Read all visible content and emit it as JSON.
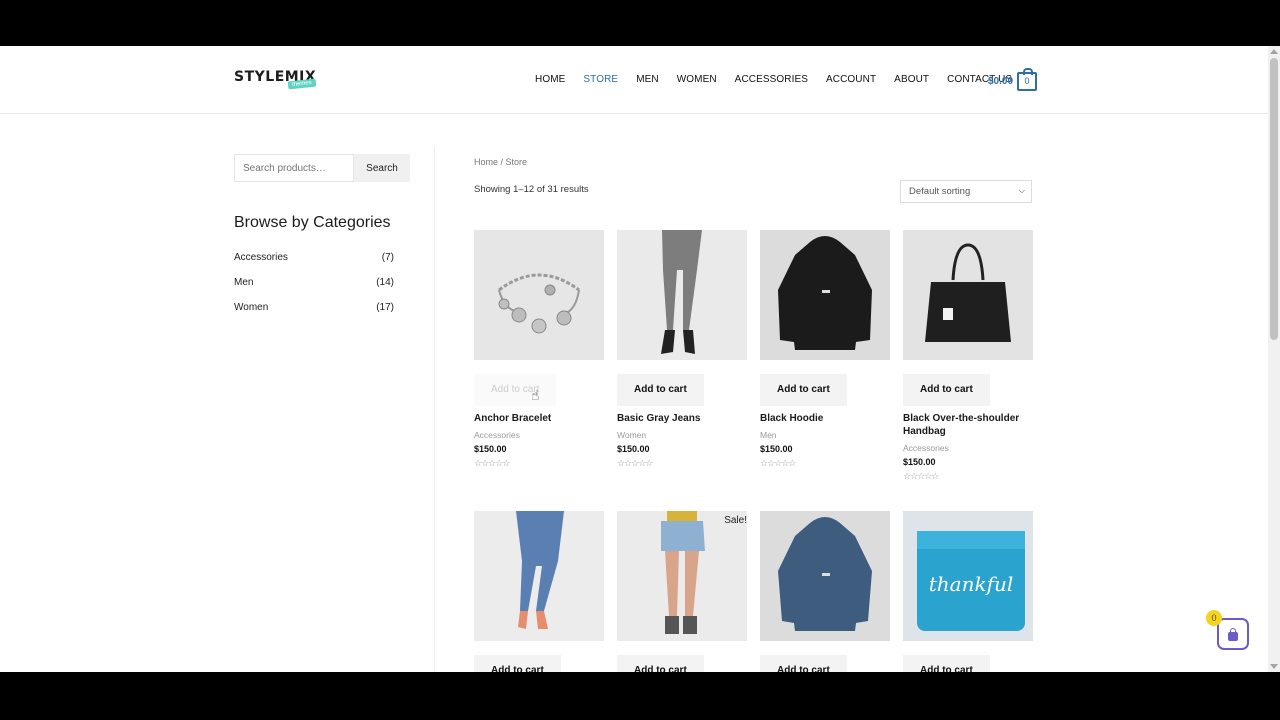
{
  "header": {
    "logo_text": "STYLEMIX",
    "logo_tag": "themes",
    "nav": [
      {
        "label": "HOME",
        "active": false
      },
      {
        "label": "STORE",
        "active": true
      },
      {
        "label": "MEN",
        "active": false
      },
      {
        "label": "WOMEN",
        "active": false
      },
      {
        "label": "ACCESSORIES",
        "active": false
      },
      {
        "label": "ACCOUNT",
        "active": false
      },
      {
        "label": "ABOUT",
        "active": false
      },
      {
        "label": "CONTACT US",
        "active": false
      }
    ],
    "cart_amount": "$0.00",
    "cart_count": "0"
  },
  "sidebar": {
    "search_placeholder": "Search products…",
    "search_button": "Search",
    "categories_title": "Browse by Categories",
    "categories": [
      {
        "name": "Accessories",
        "count": "(7)"
      },
      {
        "name": "Men",
        "count": "(14)"
      },
      {
        "name": "Women",
        "count": "(17)"
      }
    ]
  },
  "main": {
    "breadcrumb": "Home / Store",
    "result_count": "Showing 1–12 of 31 results",
    "sorting": "Default sorting",
    "products": [
      {
        "name": "Anchor Bracelet",
        "category": "Accessories",
        "price": "$150.00",
        "button": "Add to cart",
        "image": "bracelet",
        "sale": ""
      },
      {
        "name": "Basic Gray Jeans",
        "category": "Women",
        "price": "$150.00",
        "button": "Add to cart",
        "image": "gray-jeans",
        "sale": ""
      },
      {
        "name": "Black Hoodie",
        "category": "Men",
        "price": "$150.00",
        "button": "Add to cart",
        "image": "black-hoodie",
        "sale": ""
      },
      {
        "name": "Black Over-the-shoulder Handbag",
        "category": "Accessories",
        "price": "$150.00",
        "button": "Add to cart",
        "image": "handbag",
        "sale": ""
      },
      {
        "name": "",
        "category": "",
        "price": "",
        "button": "Add to cart",
        "image": "blue-jeans",
        "sale": ""
      },
      {
        "name": "",
        "category": "",
        "price": "",
        "button": "Add to cart",
        "image": "denim-shorts",
        "sale": "Sale!"
      },
      {
        "name": "",
        "category": "",
        "price": "",
        "button": "Add to cart",
        "image": "blue-hoodie",
        "sale": ""
      },
      {
        "name": "",
        "category": "",
        "price": "",
        "button": "Add to cart",
        "image": "thankful-shirt",
        "sale": ""
      }
    ],
    "shirt_text": "thankful"
  },
  "floating_cart": {
    "count": "0"
  },
  "colors": {
    "accent": "#2d6fa6",
    "float_cart": "#6a5bc7",
    "badge": "#f4d51c"
  }
}
